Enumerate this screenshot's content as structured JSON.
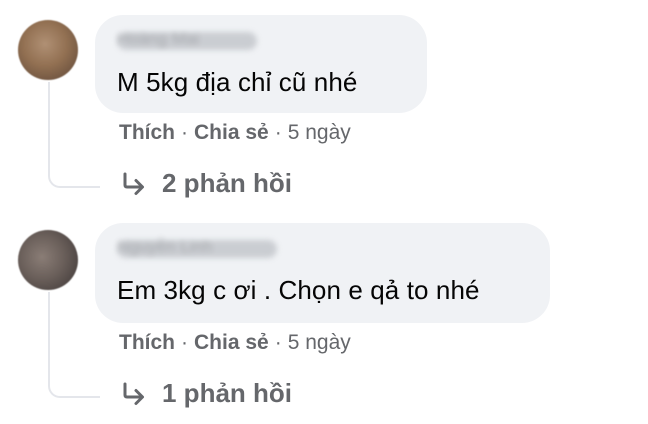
{
  "comments": [
    {
      "author": "Hoàng Mai",
      "text": "M 5kg địa chỉ cũ nhé",
      "actions": {
        "like": "Thích",
        "share": "Chia sẻ",
        "time": "5 ngày"
      },
      "replies": "2 phản hồi"
    },
    {
      "author": "Nguyễn Linh",
      "text": "Em 3kg c ơi . Chọn e qả to nhé",
      "actions": {
        "like": "Thích",
        "share": "Chia sẻ",
        "time": "5 ngày"
      },
      "replies": "1 phản hồi"
    }
  ],
  "icons": {
    "reply": "reply-arrow-icon"
  },
  "colors": {
    "bubble": "#f0f2f5",
    "meta": "#65676b",
    "text": "#050505",
    "thread": "#e4e6eb"
  }
}
